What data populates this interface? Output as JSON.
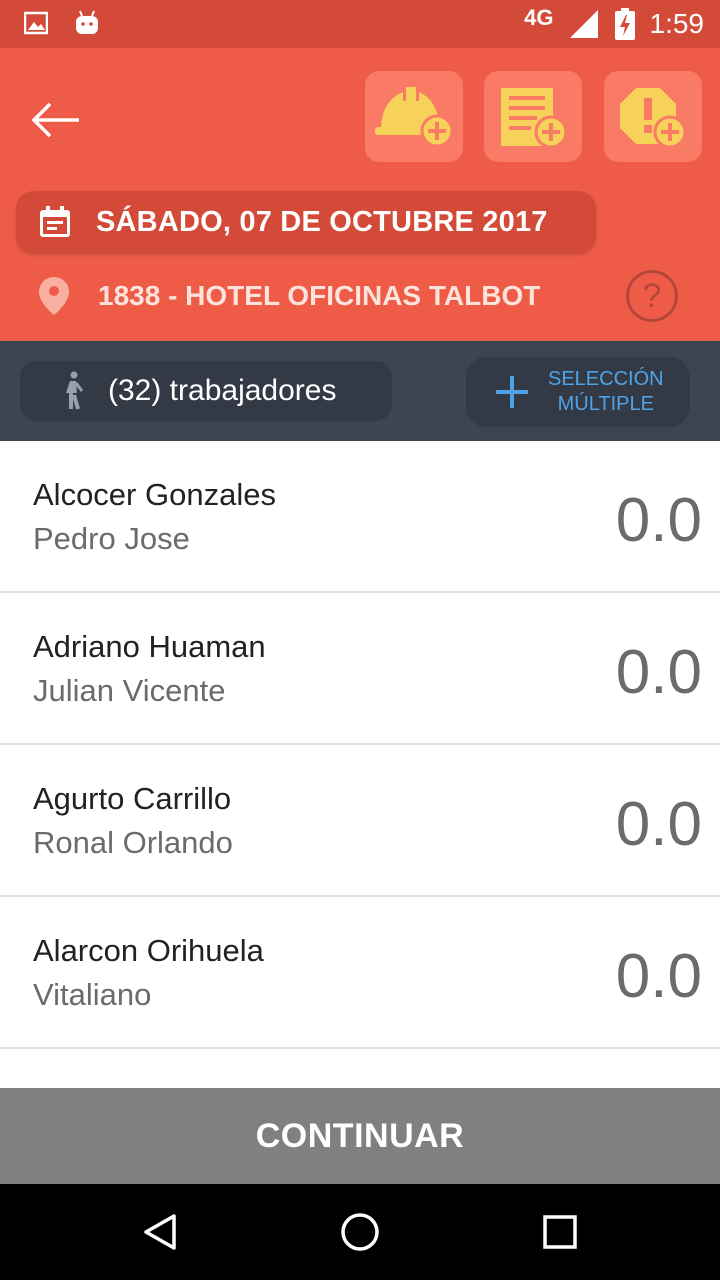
{
  "status_bar": {
    "network": "4G",
    "time": "1:59",
    "icons": [
      "image-icon",
      "android-icon",
      "signal-icon",
      "battery-charging-icon"
    ]
  },
  "header": {
    "actions": [
      {
        "name": "add-helmet-button",
        "icon": "helmet-add-icon"
      },
      {
        "name": "add-report-button",
        "icon": "document-add-icon"
      },
      {
        "name": "add-alert-button",
        "icon": "alert-add-icon"
      }
    ],
    "date": "SÁBADO, 07 DE OCTUBRE 2017",
    "location": "1838 - HOTEL OFICINAS TALBOT",
    "help_symbol": "?"
  },
  "toolbar": {
    "workers_label": "(32) trabajadores",
    "multi_line1": "SELECCIÓN",
    "multi_line2": "MÚLTIPLE"
  },
  "workers": [
    {
      "last": "Alcocer Gonzales",
      "first": "Pedro Jose",
      "value": "0.0"
    },
    {
      "last": "Adriano Huaman",
      "first": "Julian Vicente",
      "value": "0.0"
    },
    {
      "last": "Agurto Carrillo",
      "first": "Ronal Orlando",
      "value": "0.0"
    },
    {
      "last": "Alarcon Orihuela",
      "first": "Vitaliano",
      "value": "0.0"
    }
  ],
  "continue_label": "CONTINUAR",
  "colors": {
    "status_bar": "#d34b38",
    "header": "#ee5c48",
    "action_bg": "#f97a65",
    "icon_yellow": "#f7d25a",
    "toolbar": "#3d4452",
    "accent_blue": "#4fa3e6",
    "continue": "#808080"
  }
}
